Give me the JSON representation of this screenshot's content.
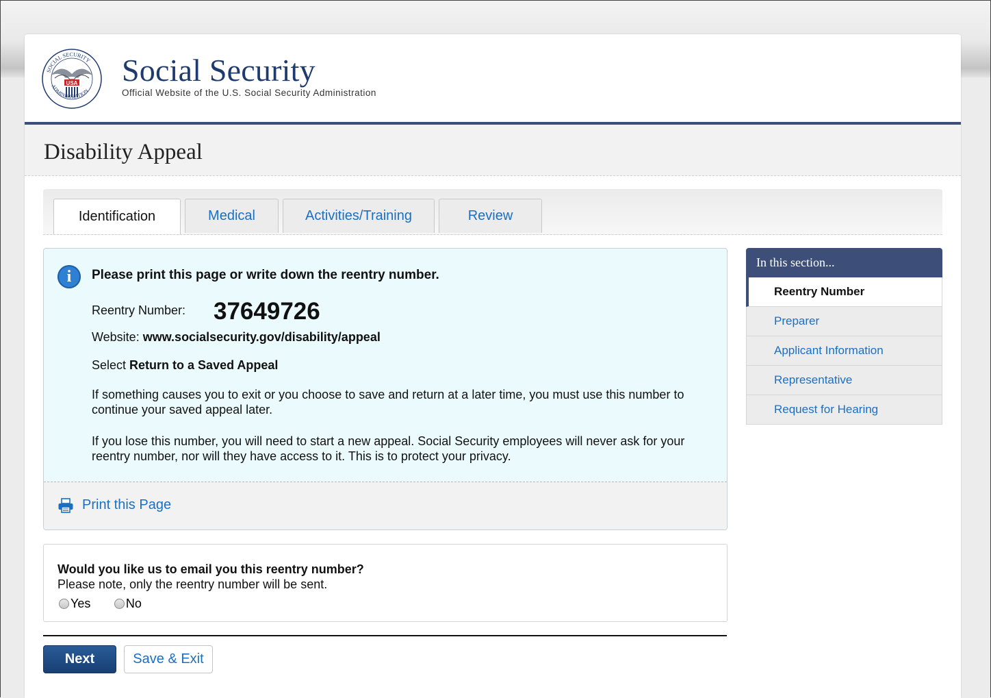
{
  "header": {
    "brand_title": "Social Security",
    "brand_subtitle": "Official Website of the U.S. Social Security Administration",
    "seal_text": "SOCIAL SECURITY ADMINISTRATION USA"
  },
  "page_title": "Disability Appeal",
  "tabs": [
    {
      "label": "Identification",
      "active": true
    },
    {
      "label": "Medical",
      "active": false
    },
    {
      "label": "Activities/Training",
      "active": false
    },
    {
      "label": "Review",
      "active": false
    }
  ],
  "notice": {
    "heading": "Please print this page or write down the reentry number.",
    "reentry_label": "Reentry Number:",
    "reentry_number": "37649726",
    "website_label": "Website:",
    "website_url": "www.socialsecurity.gov/disability/appeal",
    "select_prefix": "Select",
    "select_target": "Return to a Saved Appeal",
    "paragraph_1": "If something causes you to exit or you choose to save and return at a later time, you must use this number to continue your saved appeal later.",
    "paragraph_2": "If you lose this number, you will need to start a new appeal. Social Security employees will never ask for your reentry number, nor will they have access to it. This is to protect your privacy.",
    "print_link": "Print this Page",
    "print_icon": "printer-icon",
    "info_icon": "info-icon"
  },
  "email_prompt": {
    "question": "Would you like us to email you this reentry number?",
    "note": "Please note, only the reentry number will be sent.",
    "options": [
      "Yes",
      "No"
    ]
  },
  "actions": {
    "next_label": "Next",
    "save_exit_label": "Save & Exit"
  },
  "sidebar": {
    "heading": "In this section...",
    "items": [
      {
        "label": "Reentry Number",
        "current": true
      },
      {
        "label": "Preparer",
        "current": false
      },
      {
        "label": "Applicant Information",
        "current": false
      },
      {
        "label": "Representative",
        "current": false
      },
      {
        "label": "Request for Hearing",
        "current": false
      }
    ]
  },
  "colors": {
    "brand_navy": "#3d4f78",
    "link_blue": "#1a6fc4",
    "notice_bg": "#ebfbfd",
    "next_button": "#1f4c86"
  }
}
